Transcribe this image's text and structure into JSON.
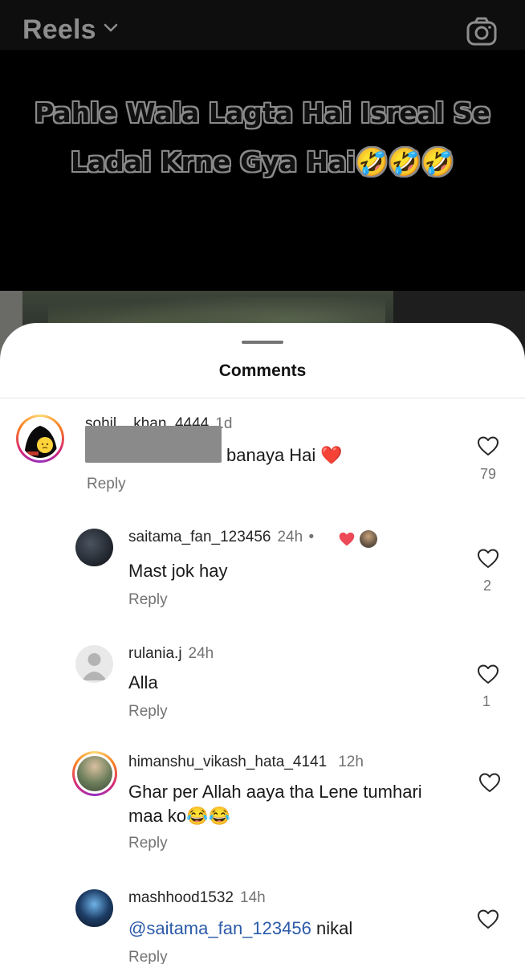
{
  "header": {
    "title": "Reels"
  },
  "video": {
    "caption": "Pahle Wala Lagta Hai Isreal Se Ladai Krne Gya Hai🤣🤣🤣"
  },
  "sheet": {
    "title": "Comments"
  },
  "comments": [
    {
      "username": "sohil__khan_4444",
      "time": "1d",
      "text": "banaya Hai ❤️",
      "reply": "Reply",
      "likes": "79",
      "text_redacted": true
    },
    {
      "username": "saitama_fan_123456",
      "time": "24h",
      "dot": "•",
      "text": "Mast jok hay",
      "reply": "Reply",
      "likes": "2",
      "author_liked": true
    },
    {
      "username": "rulania.j",
      "time": "24h",
      "text": "Alla",
      "reply": "Reply",
      "likes": "1"
    },
    {
      "username": "himanshu_vikash_hata_4141",
      "time": "12h",
      "text": "Ghar per Allah aaya tha Lene tumhari maa ko😂😂",
      "reply": "Reply"
    },
    {
      "username": "mashhood1532",
      "time": "14h",
      "mention": "@saitama_fan_123456",
      "text": " nikal",
      "reply": "Reply"
    }
  ],
  "icons": {
    "header": [
      "chevron-down-icon",
      "camera-icon"
    ],
    "comment": "heart-icon"
  },
  "colors": {
    "like_red": "#ed4956",
    "mention": "#2b5aa8",
    "muted": "#737373"
  }
}
